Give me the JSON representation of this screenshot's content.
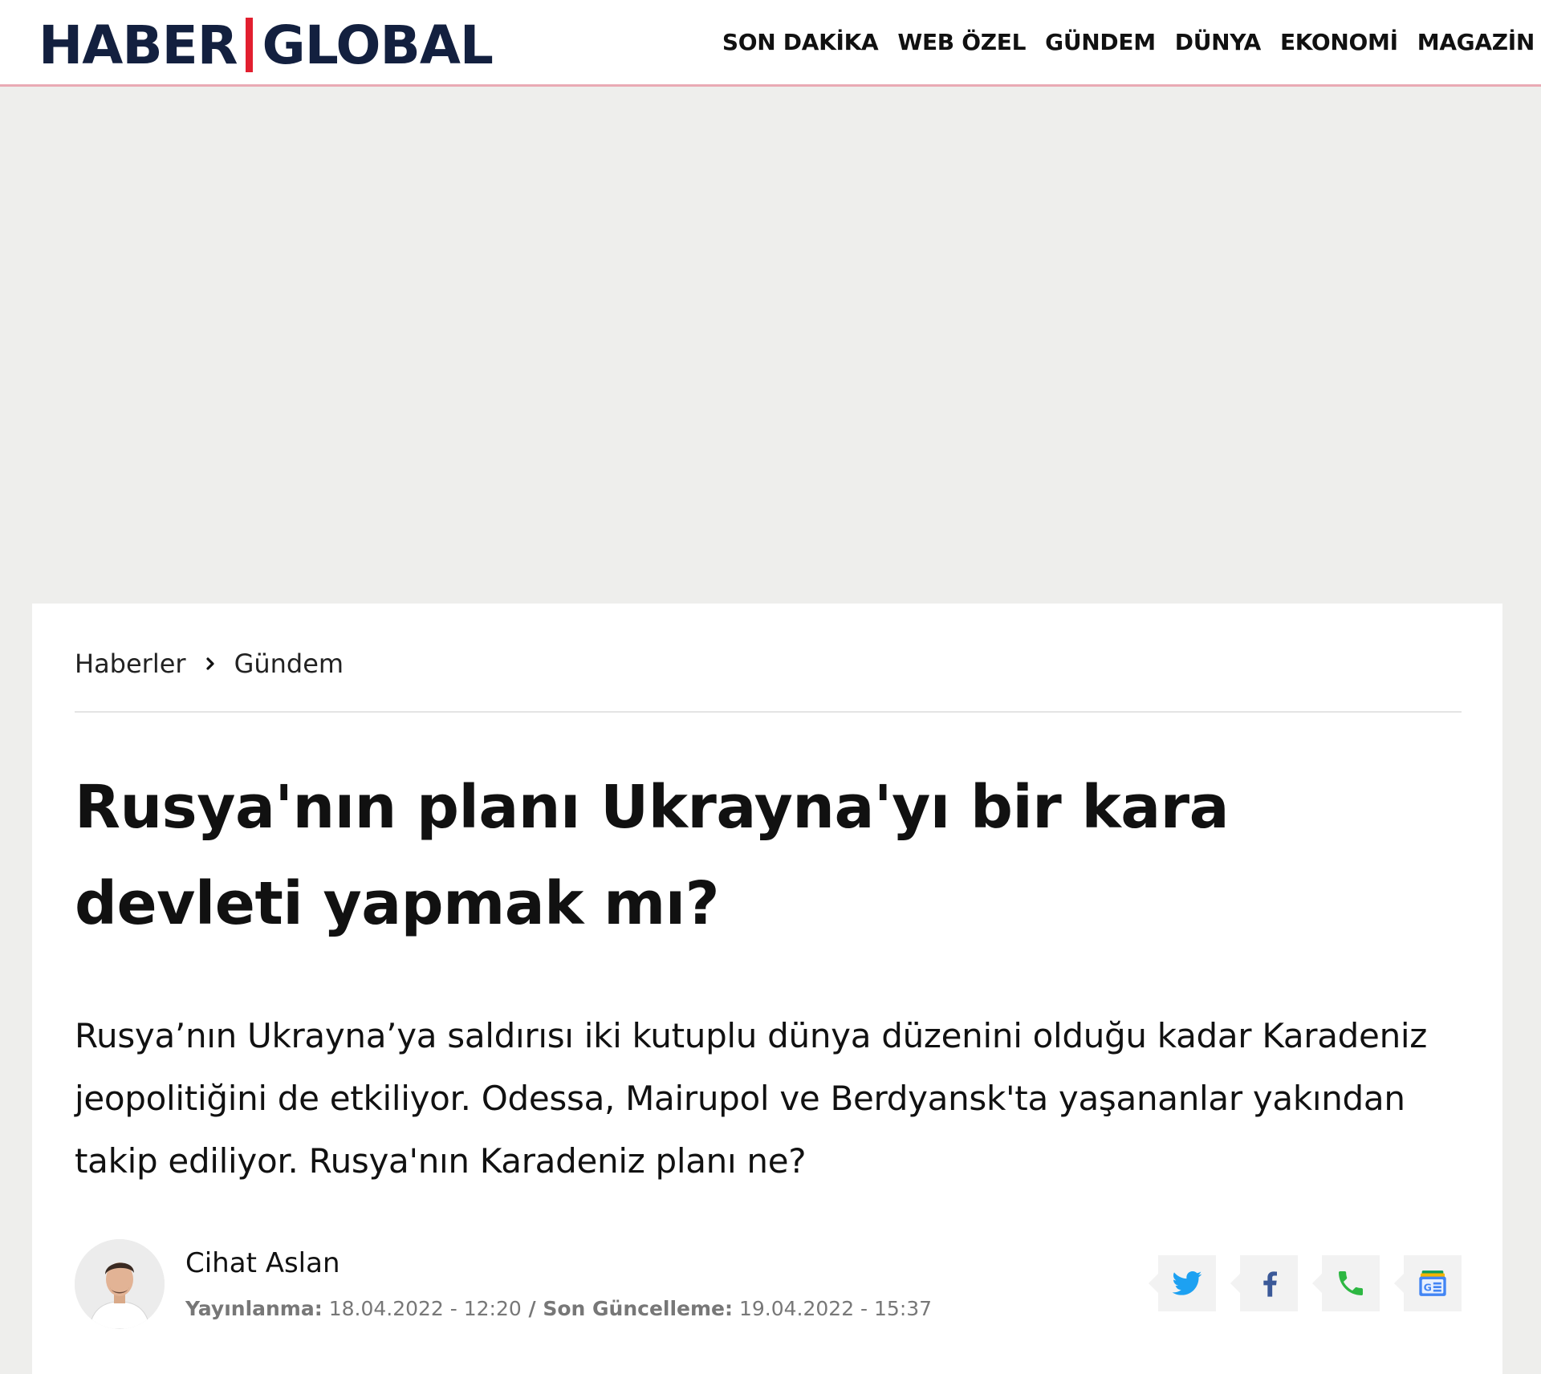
{
  "header": {
    "logo": {
      "part1": "HABER",
      "part2": "GLOBAL"
    },
    "nav": [
      "SON DAKİKA",
      "WEB ÖZEL",
      "GÜNDEM",
      "DÜNYA",
      "EKONOMİ",
      "MAGAZİN"
    ]
  },
  "breadcrumb": {
    "home": "Haberler",
    "section": "Gündem"
  },
  "article": {
    "title": "Rusya'nın planı Ukrayna'yı bir kara devleti yapmak mı?",
    "summary": "Rusya’nın Ukrayna’ya saldırısı iki kutuplu dünya düzenini olduğu kadar Karadeniz jeopolitiğini de etkiliyor. Odessa, Mairupol ve Berdyansk'ta yaşananlar yakından takip ediliyor. Rusya'nın Karadeniz planı ne?",
    "author": "Cihat Aslan",
    "published_label": "Yayınlanma:",
    "published_value": "18.04.2022  - 12:20",
    "separator": " / ",
    "updated_label": "Son Güncelleme:",
    "updated_value": "19.04.2022 - 15:37"
  },
  "share": {
    "icons": [
      "twitter-icon",
      "facebook-icon",
      "whatsapp-phone-icon",
      "google-news-icon"
    ]
  },
  "colors": {
    "brand_navy": "#13203f",
    "brand_red": "#e21f2f",
    "twitter": "#1da1f2",
    "facebook": "#3b5998",
    "whatsapp": "#2db742"
  }
}
